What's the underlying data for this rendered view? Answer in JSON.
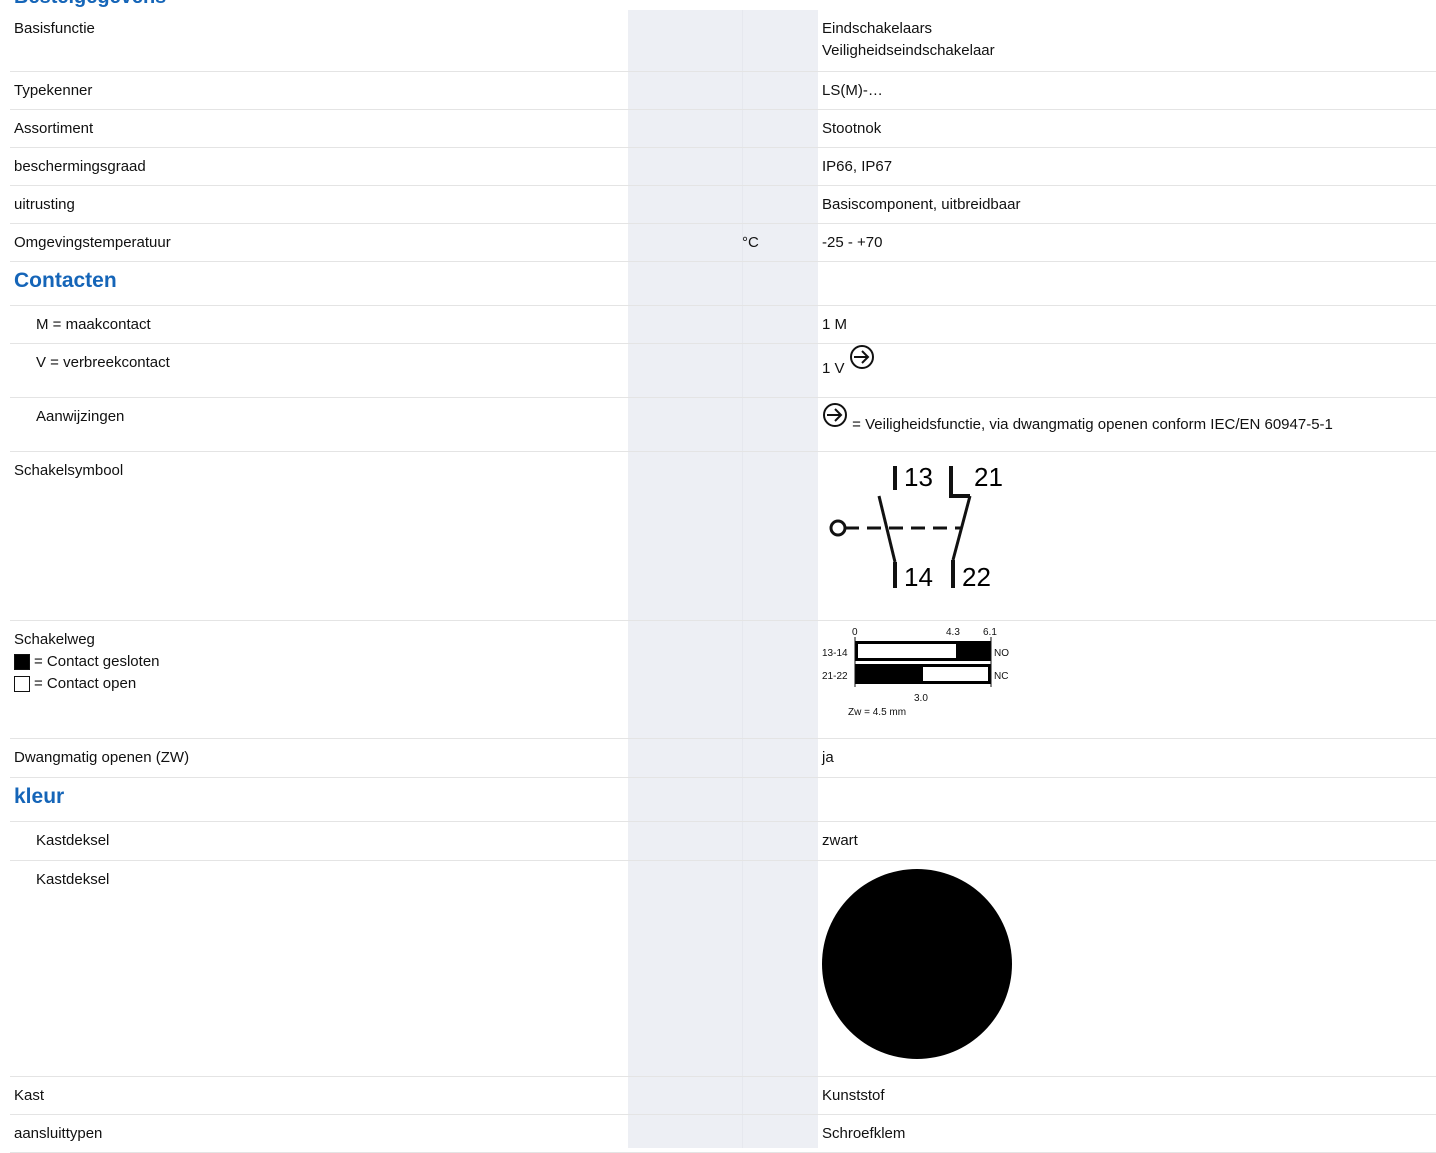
{
  "heading": "Bestelgegevens",
  "rows": {
    "basisfunctie": {
      "label": "Basisfunctie",
      "value1": "Eindschakelaars",
      "value2": "Veiligheidseindschakelaar"
    },
    "typekenner": {
      "label": "Typekenner",
      "value": "LS(M)-…"
    },
    "assortiment": {
      "label": "Assortiment",
      "value": "Stootnok"
    },
    "bescherming": {
      "label": "beschermingsgraad",
      "value": "IP66, IP67"
    },
    "uitrusting": {
      "label": "uitrusting",
      "value": "Basiscomponent, uitbreidbaar"
    },
    "temperatuur": {
      "label": "Omgevingstemperatuur",
      "unit": "°C",
      "value": "-25 - +70"
    },
    "contacten": {
      "label": "Contacten"
    },
    "maak": {
      "label": "M = maakcontact",
      "value": "1 M"
    },
    "verbreek": {
      "label": "V = verbreekcontact",
      "value": "1 V"
    },
    "aanwijzingen": {
      "label": "Aanwijzingen",
      "value": "= Veiligheidsfunctie, via dwangmatig openen conform IEC/EN 60947-5-1"
    },
    "schakelsymbool": {
      "label": "Schakelsymbool"
    },
    "schakelweg": {
      "label": "Schakelweg",
      "legend_closed": "= Contact gesloten",
      "legend_open": "= Contact open"
    },
    "dwangmatig": {
      "label": "Dwangmatig openen (ZW)",
      "value": "ja"
    },
    "kleur": {
      "label": "kleur"
    },
    "kastdeksel1": {
      "label": "Kastdeksel",
      "value": "zwart"
    },
    "kastdeksel2": {
      "label": "Kastdeksel"
    },
    "kast": {
      "label": "Kast",
      "value": "Kunststof"
    },
    "aansluit": {
      "label": "aansluittypen",
      "value": "Schroefklem"
    }
  },
  "symbol": {
    "t13": "13",
    "t14": "14",
    "t21": "21",
    "t22": "22"
  },
  "travel": {
    "tick0": "0",
    "tick43": "4.3",
    "tick61": "6.1",
    "tick30": "3.0",
    "row1": "13-14",
    "row2": "21-22",
    "no": "NO",
    "nc": "NC",
    "zw": "Zw = 4.5 mm"
  },
  "colors": {
    "accent": "#1565b8",
    "grey_column": "#edeff4",
    "cover_color": "#000000"
  }
}
